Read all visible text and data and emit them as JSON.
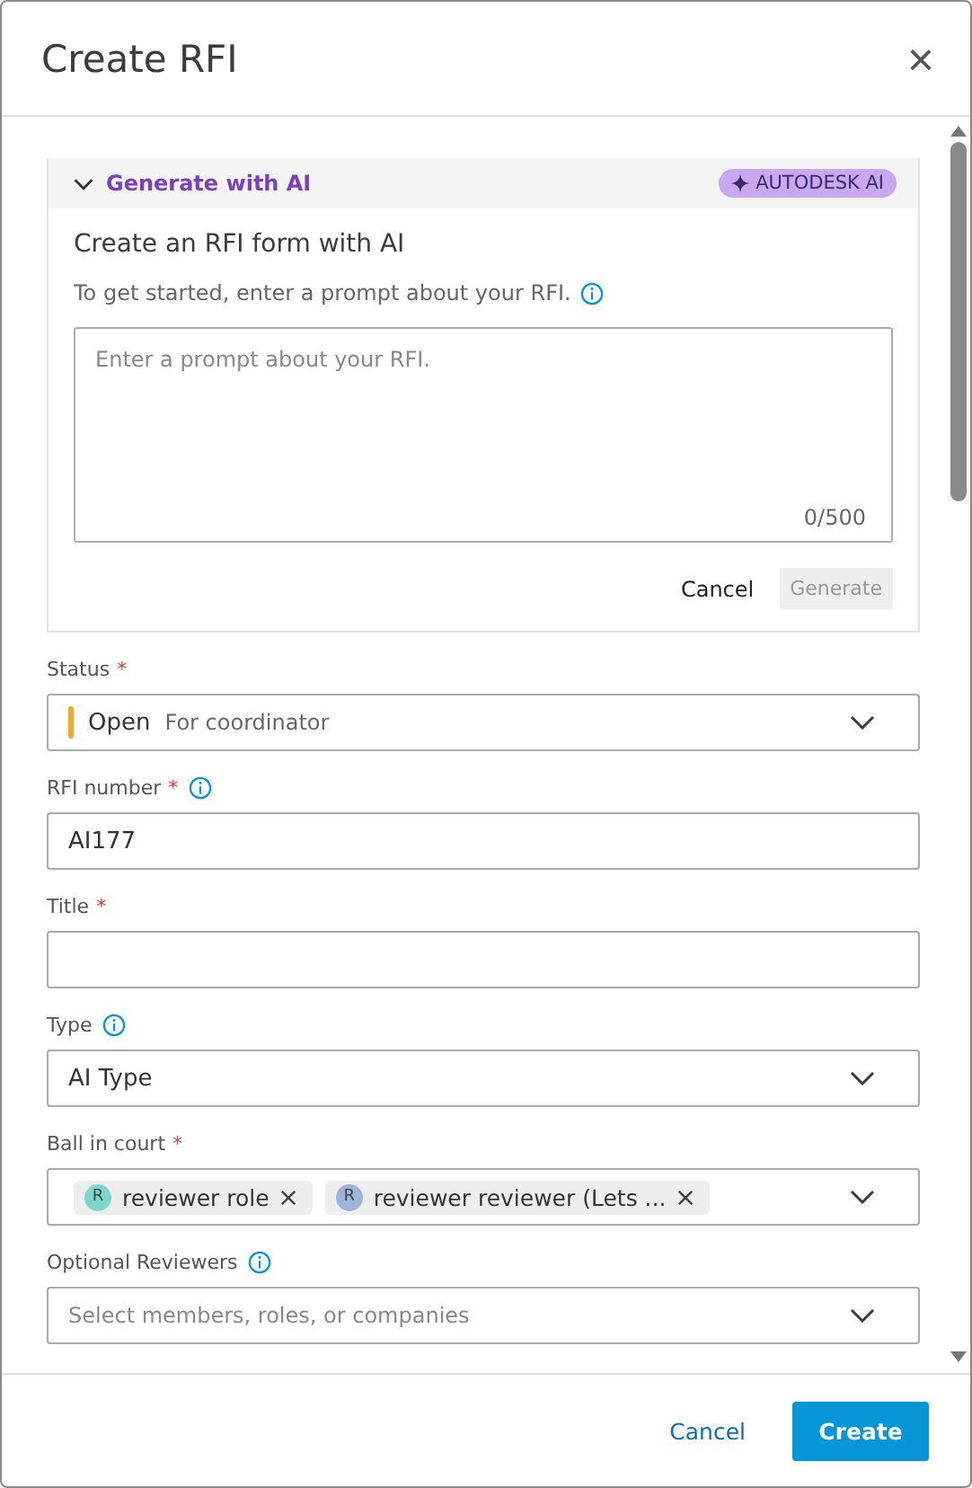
{
  "dialog": {
    "title": "Create RFI",
    "close": "×"
  },
  "ai_panel": {
    "header": "Generate with AI",
    "expanded": true,
    "badge": "AUTODESK AI",
    "heading": "Create an RFI form with AI",
    "hint": "To get started, enter a prompt about your RFI.",
    "prompt": {
      "placeholder": "Enter a prompt about your RFI.",
      "counter": "0/500"
    },
    "cancel": "Cancel",
    "generate": {
      "label": "Generate",
      "disabled": true
    }
  },
  "fields": [
    {
      "kind": "status",
      "label": "Status",
      "required": "*",
      "info": false,
      "value": "Open",
      "detail": "For coordinator",
      "color": "#f5a623"
    },
    {
      "kind": "text",
      "label": "RFI number",
      "required": "*",
      "info": true,
      "value": "AI177"
    },
    {
      "kind": "text",
      "label": "Title",
      "required": "*",
      "info": false
    },
    {
      "kind": "select",
      "label": "Type",
      "info": true,
      "value": "AI Type"
    },
    {
      "kind": "chips",
      "label": "Ball in court",
      "required": "*",
      "info": false,
      "chips": [
        {
          "initial": "R",
          "label": "reviewer role",
          "color": "#7dd8cc"
        },
        {
          "initial": "R",
          "label": "reviewer reviewer (Lets ...",
          "color": "#9db3d9"
        }
      ]
    },
    {
      "kind": "select",
      "label": "Optional Reviewers",
      "info": true,
      "placeholder": "Select members, roles, or companies"
    }
  ],
  "footer": {
    "cancel": "Cancel",
    "create": "Create"
  }
}
